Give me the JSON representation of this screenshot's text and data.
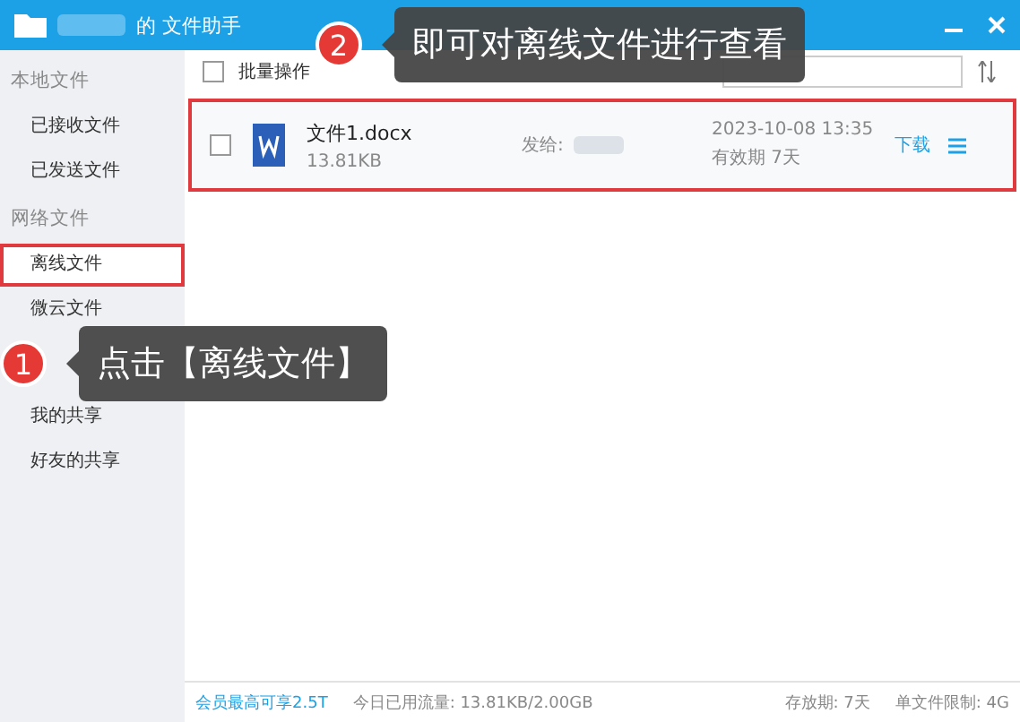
{
  "window": {
    "title": "的 文件助手"
  },
  "sidebar": {
    "sections": [
      {
        "heading": "本地文件",
        "items": [
          {
            "label": "已接收文件",
            "selected": false,
            "highlighted": false
          },
          {
            "label": "已发送文件",
            "selected": false,
            "highlighted": false
          }
        ]
      },
      {
        "heading": "网络文件",
        "items": [
          {
            "label": "离线文件",
            "selected": true,
            "highlighted": true
          },
          {
            "label": "微云文件",
            "selected": false,
            "highlighted": false
          },
          {
            "label": "我的共享",
            "selected": false,
            "highlighted": false
          },
          {
            "label": "好友的共享",
            "selected": false,
            "highlighted": false
          }
        ]
      }
    ]
  },
  "toolbar": {
    "batch_label": "批量操作",
    "select_all_checked": false
  },
  "files": [
    {
      "name": "文件1.docx",
      "size": "13.81KB",
      "sent_to_label": "发给:",
      "date": "2023-10-08 13:35",
      "validity": "有效期 7天",
      "download": "下载",
      "checked": false,
      "highlighted": true
    }
  ],
  "footer": {
    "member": "会员最高可享2.5T",
    "traffic": "今日已用流量: 13.81KB/2.00GB",
    "retention": "存放期: 7天",
    "limit": "单文件限制: 4G"
  },
  "callouts": [
    {
      "number": "1",
      "text": "点击【离线文件】"
    },
    {
      "number": "2",
      "text": "即可对离线文件进行查看"
    }
  ]
}
